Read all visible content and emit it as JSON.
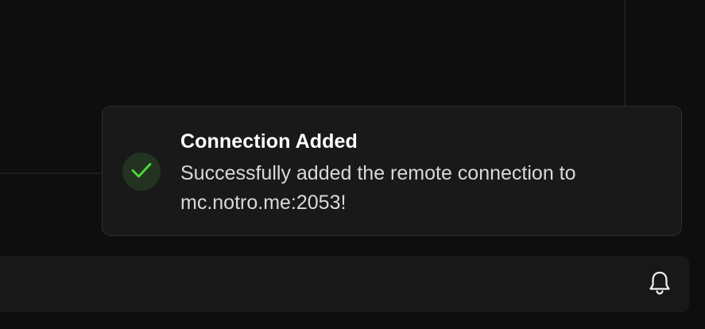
{
  "toast": {
    "title": "Connection Added",
    "message": "Successfully added the remote connection to mc.notro.me:2053!",
    "icon": "check-icon",
    "status_color": "#4cdb3a"
  },
  "bottom_bar": {
    "notifications_icon": "bell-icon"
  },
  "colors": {
    "background": "#0e0e0e",
    "toast_background": "#191919",
    "bar_background": "#181818"
  }
}
